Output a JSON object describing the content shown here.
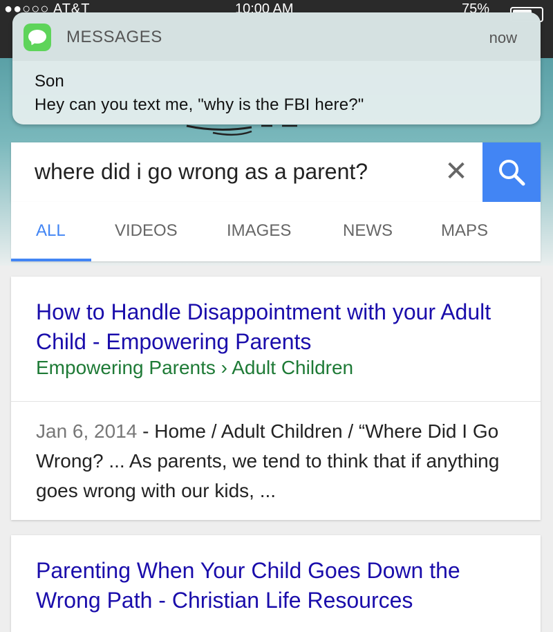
{
  "status_bar": {
    "carrier": "●●○○○ AT&T",
    "time": "10:00 AM",
    "battery": "75%",
    "battery_level": 0.75
  },
  "notification": {
    "app_name": "MESSAGES",
    "time": "now",
    "sender": "Son",
    "message": "Hey can you text me, \"why is the FBI here?\""
  },
  "search": {
    "query": "where did i go wrong as a parent?",
    "clear_symbol": "✕",
    "search_icon": "magnifier-icon"
  },
  "tabs": [
    {
      "label": "ALL",
      "active": true
    },
    {
      "label": "VIDEOS",
      "active": false
    },
    {
      "label": "IMAGES",
      "active": false
    },
    {
      "label": "NEWS",
      "active": false
    },
    {
      "label": "MAPS",
      "active": false
    }
  ],
  "results": [
    {
      "title": "How to Handle Disappointment with your Adult Child - Empowering Parents",
      "url": "Empowering Parents › Adult Children",
      "date": "Jan 6, 2014",
      "snippet": " - Home / Adult Children / “Where Did I Go Wrong? ... As parents, we tend to think that if anything goes wrong with our kids, ..."
    },
    {
      "title": "Parenting When Your Child Goes Down the Wrong Path - Christian Life Resources"
    }
  ],
  "colors": {
    "accent": "#4285f4",
    "link": "#1a0dab",
    "url": "#1e7a36",
    "app_icon": "#5ed45a"
  }
}
